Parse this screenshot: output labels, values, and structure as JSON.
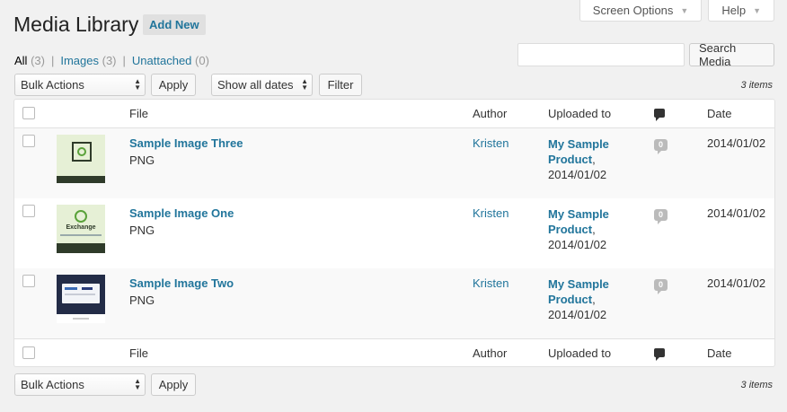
{
  "screen_meta": {
    "screen_options_label": "Screen Options",
    "help_label": "Help"
  },
  "header": {
    "title": "Media Library",
    "add_new_label": "Add New"
  },
  "views": [
    {
      "label": "All",
      "count": "(3)"
    },
    {
      "label": "Images",
      "count": "(3)"
    },
    {
      "label": "Unattached",
      "count": "(0)"
    }
  ],
  "views_separator": "|",
  "search": {
    "value": "",
    "button_label": "Search Media"
  },
  "tablenav_top": {
    "bulk_actions_selected": "Bulk Actions",
    "apply_label": "Apply",
    "dates_selected": "Show all dates",
    "filter_label": "Filter",
    "items_count": "3 items"
  },
  "columns": {
    "file": "File",
    "author": "Author",
    "uploaded_to": "Uploaded to",
    "date": "Date"
  },
  "rows": [
    {
      "title": "Sample Image Three",
      "type": "PNG",
      "author": "Kristen",
      "uploaded_to": "My Sample Product",
      "uploaded_date": "2014/01/02",
      "comments": "0",
      "date": "2014/01/02"
    },
    {
      "title": "Sample Image One",
      "type": "PNG",
      "author": "Kristen",
      "uploaded_to": "My Sample Product",
      "uploaded_date": "2014/01/02",
      "comments": "0",
      "date": "2014/01/02",
      "thumb_text": "Exchange"
    },
    {
      "title": "Sample Image Two",
      "type": "PNG",
      "author": "Kristen",
      "uploaded_to": "My Sample Product",
      "uploaded_date": "2014/01/02",
      "comments": "0",
      "date": "2014/01/02"
    }
  ],
  "tablenav_bottom": {
    "bulk_actions_selected": "Bulk Actions",
    "apply_label": "Apply",
    "items_count": "3 items"
  },
  "colors": {
    "link": "#21759b",
    "background": "#f1f1f1",
    "comment_bubble": "#bbbbbb"
  }
}
